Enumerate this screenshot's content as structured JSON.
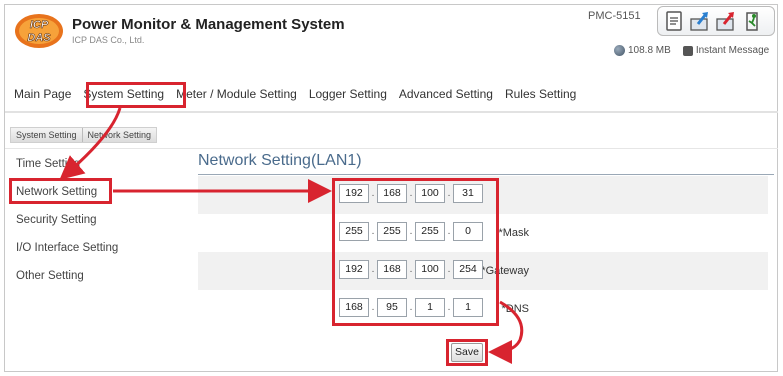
{
  "header": {
    "logo_text": "ICP DAS",
    "title": "Power Monitor & Management System",
    "company": "ICP DAS Co., Ltd.",
    "model": "PMC-5151",
    "memory": "108.8 MB",
    "instant_message": "Instant Message"
  },
  "menu": {
    "items": [
      "Main Page",
      "System Setting",
      "Meter / Module Setting",
      "Logger Setting",
      "Advanced Setting",
      "Rules Setting"
    ]
  },
  "breadcrumb": [
    "System Setting",
    "Network Setting"
  ],
  "sidebar": {
    "items": [
      "Time Setting",
      "Network Setting",
      "Security Setting",
      "I/O Interface Setting",
      "Other Setting"
    ]
  },
  "content": {
    "title": "Network Setting(LAN1)",
    "rows": [
      {
        "label": "",
        "octets": [
          "192",
          "168",
          "100",
          "31"
        ]
      },
      {
        "label": "*Mask",
        "octets": [
          "255",
          "255",
          "255",
          "0"
        ]
      },
      {
        "label": "*Gateway",
        "octets": [
          "192",
          "168",
          "100",
          "254"
        ]
      },
      {
        "label": "*DNS",
        "octets": [
          "168",
          "95",
          "1",
          "1"
        ]
      }
    ],
    "save_label": "Save"
  },
  "colors": {
    "highlight": "#d8242f",
    "title_blue": "#4a6b8c",
    "logo_orange": "#e8731c"
  }
}
